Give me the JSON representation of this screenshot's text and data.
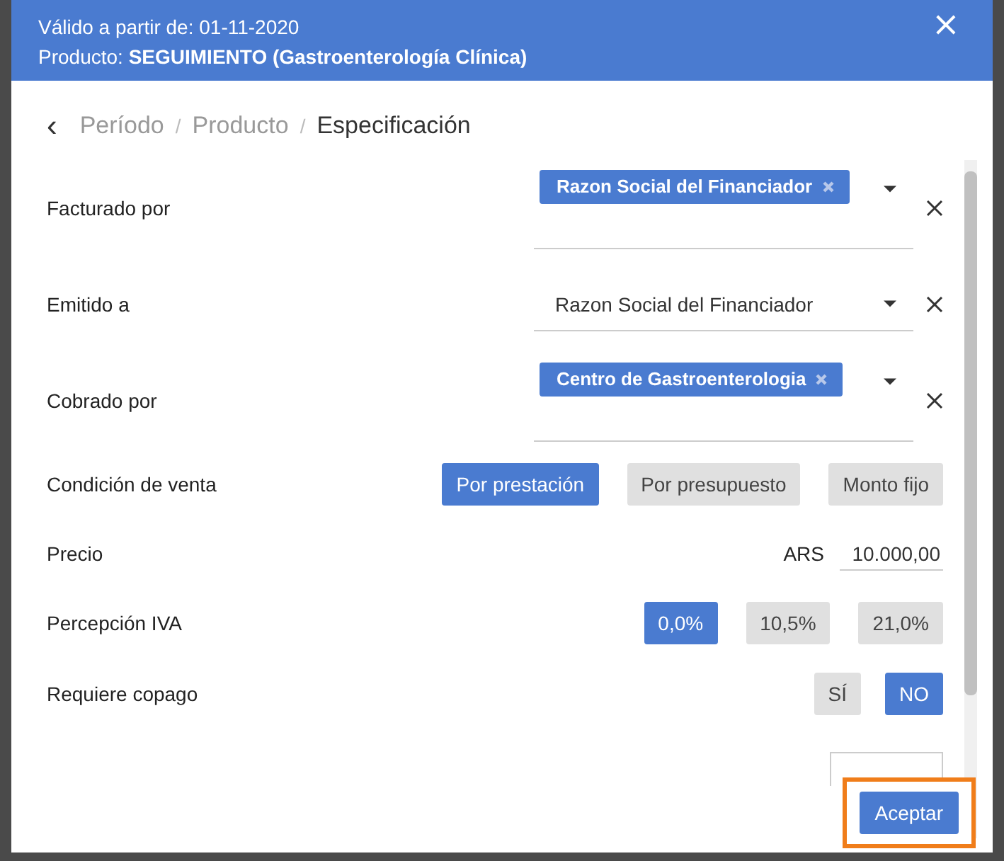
{
  "header": {
    "lines": [
      "Válido a partir de: 01-11-2020",
      "Producto: **SEGUIMIENTO (Gastroenterología Clínica)**"
    ],
    "close": "×"
  },
  "breadcrumb": {
    "back": "‹",
    "items": [
      {
        "label": "Período",
        "current": false
      },
      {
        "label": "Producto",
        "current": false
      },
      {
        "label": "Especificación",
        "current": true
      }
    ],
    "separator": "/"
  },
  "rows": [
    {
      "kind": "multiselect",
      "label": "Facturado por",
      "chips": [
        "Razon Social del Financiador"
      ]
    },
    {
      "kind": "select",
      "label": "Emitido a",
      "value": "Razon Social del Financiador"
    },
    {
      "kind": "multiselect",
      "label": "Cobrado por",
      "chips": [
        "Centro de Gastroenterologia"
      ]
    },
    {
      "kind": "choice",
      "label": "Condición de venta",
      "options": [
        {
          "label": "Por prestación",
          "selected": true
        },
        {
          "label": "Por presupuesto",
          "selected": false
        },
        {
          "label": "Monto fijo",
          "selected": false
        }
      ]
    },
    {
      "kind": "price",
      "label": "Precio",
      "currency": "ARS",
      "value": "10.000,00"
    },
    {
      "kind": "choice",
      "label": "Percepción IVA",
      "options": [
        {
          "label": "0,0%",
          "selected": true
        },
        {
          "label": "10,5%",
          "selected": false
        },
        {
          "label": "21,0%",
          "selected": false
        }
      ]
    },
    {
      "kind": "choice",
      "label": "Requiere copago",
      "options": [
        {
          "label": "SÍ",
          "selected": false
        },
        {
          "label": "NO",
          "selected": true
        }
      ]
    },
    {
      "kind": "input"
    }
  ],
  "footer": {
    "button": "Aceptar",
    "highlighted": true
  }
}
